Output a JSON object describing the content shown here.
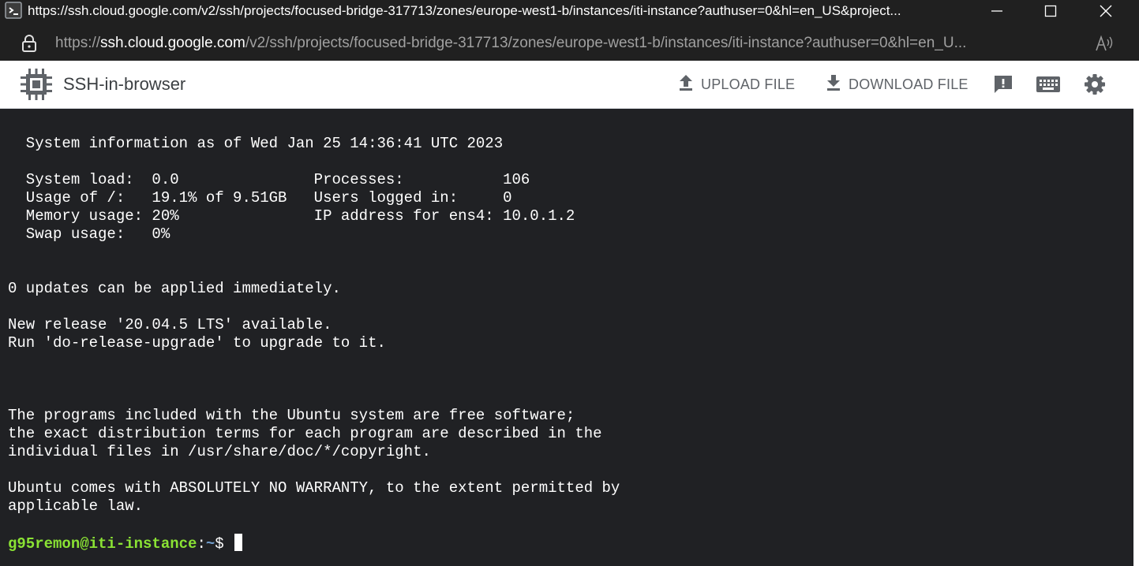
{
  "window": {
    "title": "https://ssh.cloud.google.com/v2/ssh/projects/focused-bridge-317713/zones/europe-west1-b/instances/iti-instance?authuser=0&hl=en_US&project..."
  },
  "address_bar": {
    "scheme": "https://",
    "host": "ssh.cloud.google.com",
    "path": "/v2/ssh/projects/focused-bridge-317713/zones/europe-west1-b/instances/iti-instance?authuser=0&hl=en_U..."
  },
  "app_bar": {
    "title": "SSH-in-browser",
    "upload_label": "UPLOAD FILE",
    "download_label": "DOWNLOAD FILE"
  },
  "terminal": {
    "lines": [
      "  System information as of Wed Jan 25 14:36:41 UTC 2023",
      "",
      "  System load:  0.0               Processes:           106",
      "  Usage of /:   19.1% of 9.51GB   Users logged in:     0",
      "  Memory usage: 20%               IP address for ens4: 10.0.1.2",
      "  Swap usage:   0%",
      "",
      "",
      "0 updates can be applied immediately.",
      "",
      "New release '20.04.5 LTS' available.",
      "Run 'do-release-upgrade' to upgrade to it.",
      "",
      "",
      "",
      "The programs included with the Ubuntu system are free software;",
      "the exact distribution terms for each program are described in the",
      "individual files in /usr/share/doc/*/copyright.",
      "",
      "Ubuntu comes with ABSOLUTELY NO WARRANTY, to the extent permitted by",
      "applicable law.",
      ""
    ],
    "prompt_user": "g95remon@iti-instance",
    "prompt_sep": ":",
    "prompt_path": "~",
    "prompt_symbol": "$ "
  }
}
